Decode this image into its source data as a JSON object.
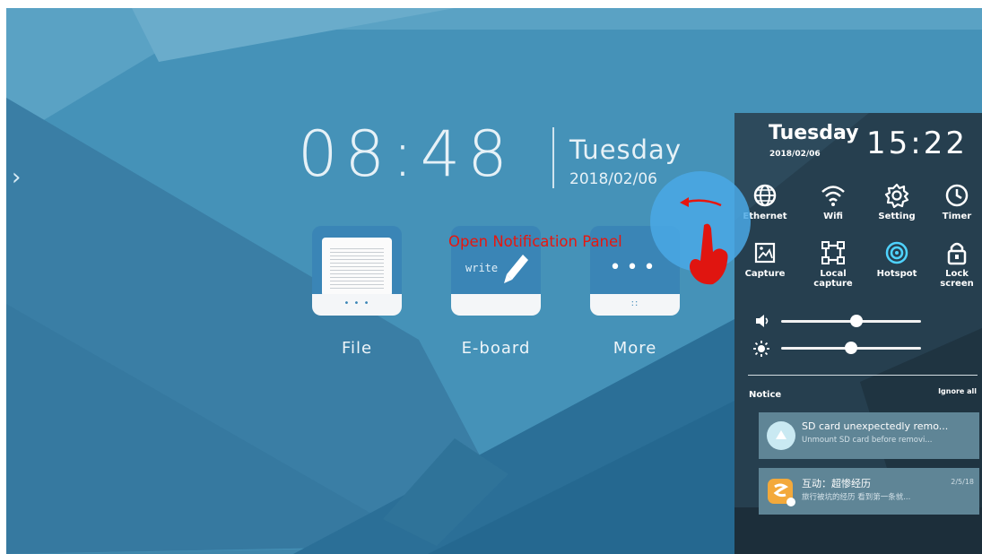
{
  "home": {
    "time": "08:48",
    "day": "Tuesday",
    "date": "2018/02/06",
    "apps": [
      {
        "label": "File",
        "icon": "file-icon"
      },
      {
        "label": "E-board",
        "icon": "eboard-icon",
        "icon_text": "write"
      },
      {
        "label": "More",
        "icon": "more-icon"
      }
    ]
  },
  "annotation": {
    "label": "Open Notification Panel",
    "color": "#e8160e"
  },
  "panel": {
    "day": "Tuesday",
    "date": "2018/02/06",
    "time": "15:22",
    "quick_settings": [
      {
        "label": "Ethernet",
        "icon": "globe-icon"
      },
      {
        "label": "Wifi",
        "icon": "wifi-icon"
      },
      {
        "label": "Setting",
        "icon": "gear-icon"
      },
      {
        "label": "Timer",
        "icon": "clock-icon"
      },
      {
        "label": "Capture",
        "icon": "screenshot-icon"
      },
      {
        "label": "Local capture",
        "icon": "crop-icon"
      },
      {
        "label": "Hotspot",
        "icon": "hotspot-icon"
      },
      {
        "label": "Lock screen",
        "icon": "lock-icon"
      }
    ],
    "volume": {
      "icon": "speaker-icon",
      "level": 0.55
    },
    "brightness": {
      "icon": "brightness-icon",
      "level": 0.5
    },
    "notice": {
      "title": "Notice",
      "ignore_all": "Ignore all",
      "items": [
        {
          "title": "SD card unexpectedly remo...",
          "subtitle": "Unmount SD card before removi...",
          "time": "",
          "icon": "sd-card-icon"
        },
        {
          "title": "互动：超惨经历",
          "subtitle": "旅行被坑的经历 看到第一条就...",
          "time": "2/5/18",
          "icon": "chat-app-icon"
        }
      ]
    }
  },
  "colors": {
    "background": "#3f86ab",
    "panel": "#243b4a",
    "accent_circle": "#4aa8e5"
  }
}
